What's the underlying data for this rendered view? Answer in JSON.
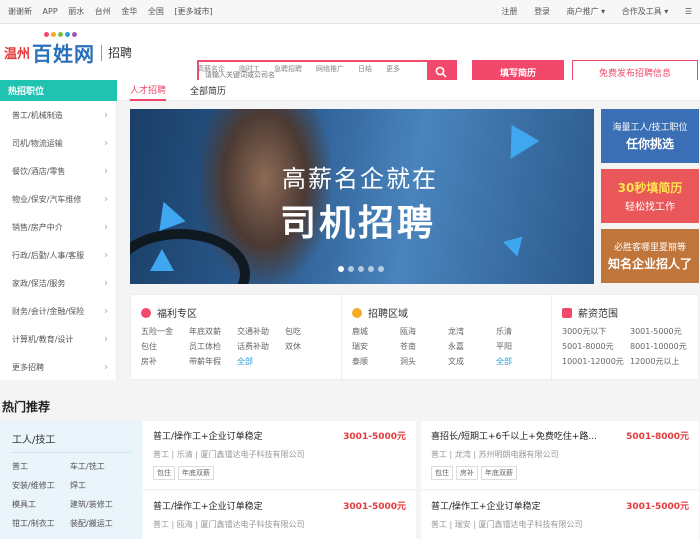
{
  "topbar": {
    "left": [
      "谢谢新",
      "APP",
      "丽水",
      "台州",
      "金华",
      "全国",
      "[更多城市]"
    ],
    "right": [
      "注册",
      "登录",
      "商户推广 ▾",
      "合作及工具 ▾",
      "☰"
    ]
  },
  "logo": {
    "city": "温州",
    "brand": "百姓网",
    "sub": "招聘"
  },
  "search": {
    "placeholder": "请输入关键词或公司名"
  },
  "buttons": {
    "post_resume": "填写简历",
    "free_post": "免费发布招聘信息"
  },
  "hotwords": [
    "高薪名企",
    "临时工",
    "急聘招聘",
    "网络推广",
    "日结",
    "更多"
  ],
  "nav": {
    "category_head": "热招职位",
    "tab_talent": "人才招聘",
    "tab_resume": "全部简历"
  },
  "sidebar": [
    "普工/机械制造",
    "司机/物流运输",
    "餐饮/酒店/零售",
    "物业/保安/汽车维修",
    "销售/房产中介",
    "行政/后勤/人事/客服",
    "家政/保洁/服务",
    "财务/会计/金融/保险",
    "计算机/教育/设计",
    "更多招聘"
  ],
  "banner": {
    "line1": "高薪名企就在",
    "line2": "司机招聘"
  },
  "promos": [
    {
      "a": "海量工人/技工职位",
      "b": "任你挑选",
      "color": "#3a6fb5"
    },
    {
      "a": "30秒填简历",
      "b": "轻松找工作",
      "color": "#e9575b"
    },
    {
      "a": "必胜客哪里夏丽等",
      "b": "知名企业招人了",
      "color": "#c0763b"
    }
  ],
  "welfare": {
    "title": "福利专区",
    "items": [
      "五险一金",
      "年底双薪",
      "交通补助",
      "包吃",
      "包住",
      "员工体检",
      "话费补助",
      "双休",
      "房补",
      "带薪年假",
      "全部"
    ]
  },
  "region": {
    "title": "招聘区域",
    "items": [
      "鹿城",
      "瓯海",
      "龙湾",
      "乐清",
      "瑞安",
      "苍南",
      "永嘉",
      "平阳",
      "泰顺",
      "洞头",
      "文成",
      "全部"
    ]
  },
  "salary": {
    "title": "薪资范围",
    "items": [
      "3000元以下",
      "3001-5000元",
      "5001-8000元",
      "8001-10000元",
      "10001-12000元",
      "12000元以上"
    ]
  },
  "hot": {
    "title": "热门推荐"
  },
  "cat_panel": {
    "title": "工人/技工",
    "items": [
      "普工",
      "车工/铣工",
      "安装/维修工",
      "焊工",
      "模具工",
      "建筑/装修工",
      "钳工/制衣工",
      "装配/搬运工"
    ]
  },
  "jobs": [
    {
      "title": "普工/操作工+企业订单稳定",
      "salary": "3001-5000元",
      "meta": "普工 | 乐清 | 厦门鑫镭达电子科技有限公司",
      "tags": [
        "包住",
        "年底双薪"
      ]
    },
    {
      "title": "喜招长/短期工+6千以上+免费吃住+路...",
      "salary": "5001-8000元",
      "meta": "普工 | 龙湾 | 苏州明朗电器有限公司",
      "tags": [
        "包住",
        "房补",
        "年底双薪"
      ]
    },
    {
      "title": "普工/操作工+企业订单稳定",
      "salary": "3001-5000元",
      "meta": "普工 | 瓯海 | 厦门鑫镭达电子科技有限公司",
      "tags": []
    },
    {
      "title": "普工/操作工+企业订单稳定",
      "salary": "3001-5000元",
      "meta": "普工 | 瑞安 | 厦门鑫镭达电子科技有限公司",
      "tags": []
    }
  ]
}
